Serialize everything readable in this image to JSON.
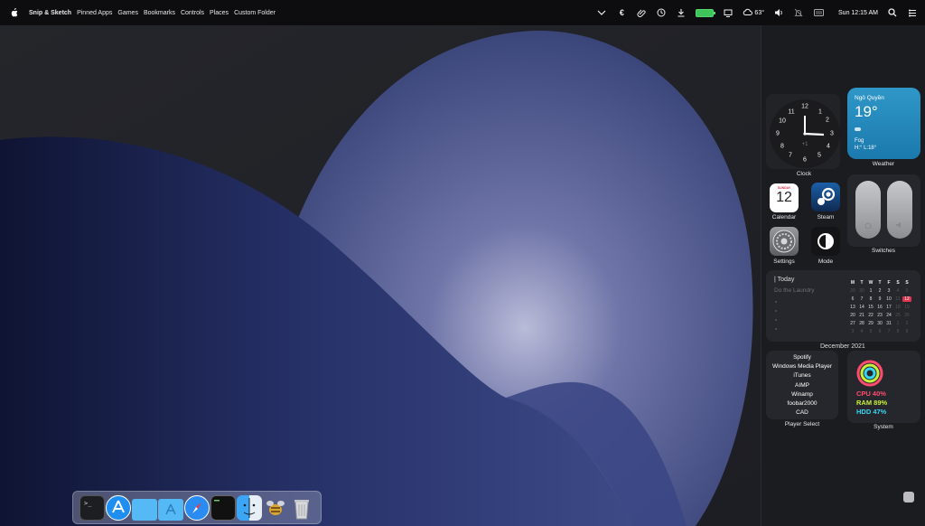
{
  "menubar": {
    "app_name": "Snip & Sketch",
    "menus": [
      "Pinned Apps",
      "Games",
      "Bookmarks",
      "Controls",
      "Places",
      "Custom Folder"
    ],
    "weather_temp": "63°",
    "datetime": "Sun 12:15 AM",
    "icons": [
      "apple-icon",
      "chevron-down-icon",
      "euro-icon",
      "paperclip-icon",
      "history-icon",
      "download-icon",
      "battery-icon",
      "display-icon",
      "cloud-icon",
      "volume-icon",
      "no-bell-icon",
      "keyboard-icon",
      "search-icon",
      "control-center-icon"
    ],
    "battery_color": "#3ec45a"
  },
  "widgets": {
    "clock": {
      "label": "Clock",
      "numerals": [
        "12",
        "1",
        "2",
        "3",
        "4",
        "5",
        "6",
        "7",
        "8",
        "9",
        "10",
        "11"
      ],
      "offset": "+1"
    },
    "weather": {
      "label": "Weather",
      "city": "Ngô Quyền",
      "temperature": "19°",
      "condition": "Fog",
      "high_low": "H:° L:18°",
      "background": "#2388bd"
    },
    "apps": [
      {
        "label": "Calendar",
        "weekday": "SUNDAY",
        "day": "12",
        "icon": "calendar-icon"
      },
      {
        "label": "Steam",
        "icon": "steam-icon"
      },
      {
        "label": "Settings",
        "icon": "settings-icon"
      },
      {
        "label": "Mode",
        "icon": "mode-icon"
      }
    ],
    "switches": {
      "label": "Switches"
    },
    "today": {
      "title": "| Today",
      "subtitle": "Do the Laundry"
    },
    "calendar": {
      "month": "December 2021",
      "weekdays": [
        "M",
        "T",
        "W",
        "T",
        "F",
        "S",
        "S"
      ],
      "weeks": [
        [
          "29",
          "30",
          "1",
          "2",
          "3",
          "4",
          "5"
        ],
        [
          "6",
          "7",
          "8",
          "9",
          "10",
          "11",
          "12"
        ],
        [
          "13",
          "14",
          "15",
          "16",
          "17",
          "18",
          "19"
        ],
        [
          "20",
          "21",
          "22",
          "23",
          "24",
          "25",
          "26"
        ],
        [
          "27",
          "28",
          "29",
          "30",
          "31",
          "1",
          "2"
        ],
        [
          "3",
          "4",
          "5",
          "6",
          "7",
          "8",
          "9"
        ]
      ],
      "today": "12",
      "today_color": "#e0344c"
    },
    "player_select": {
      "label": "Player Select",
      "players": [
        "Spotify",
        "Windows Media Player",
        "iTunes",
        "AIMP",
        "Winamp",
        "foobar2000",
        "CAD"
      ]
    },
    "system": {
      "label": "System",
      "cpu": "CPU 40%",
      "ram": "RAM 89%",
      "hdd": "HDD 47%",
      "cpu_color": "#ff4b6e",
      "ram_color": "#c6f03a",
      "hdd_color": "#35d6f2"
    }
  },
  "dock": {
    "items": [
      "terminal-icon",
      "app-store-icon",
      "folder-icon",
      "applications-folder-icon",
      "safari-icon",
      "terminal-dark-icon",
      "finder-icon",
      "bee-icon",
      "trash-icon"
    ]
  }
}
